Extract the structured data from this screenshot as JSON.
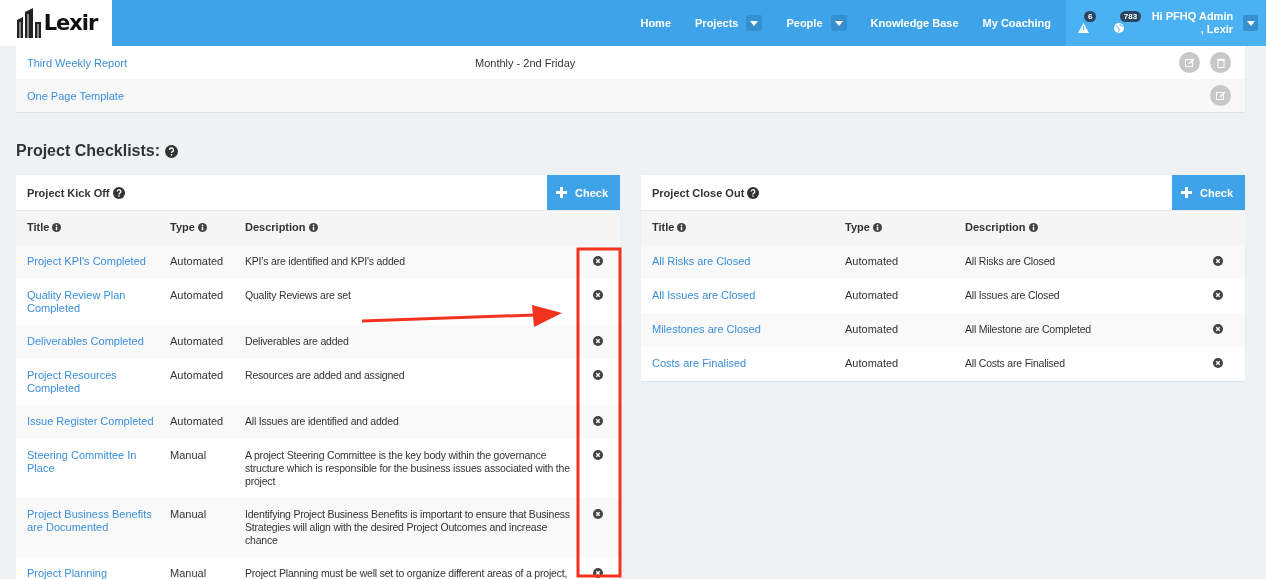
{
  "nav": {
    "logo": "Lexir",
    "items": [
      {
        "label": "Home",
        "dropdown": false
      },
      {
        "label": "Projects",
        "dropdown": true
      },
      {
        "label": "People",
        "dropdown": true
      },
      {
        "label": "Knowledge Base",
        "dropdown": false
      },
      {
        "label": "My Coaching",
        "dropdown": false
      }
    ],
    "alerts": [
      {
        "kind": "warning",
        "count": "6"
      },
      {
        "kind": "globe",
        "count": "783"
      }
    ],
    "user": "Hi PFHQ Admin , Lexir"
  },
  "reports": [
    {
      "name": "Third Weekly Report",
      "schedule": "Monthly - 2nd Friday",
      "actions": [
        {
          "kind": "edit"
        },
        {
          "kind": "delete"
        }
      ]
    },
    {
      "name": "One Page Template",
      "actions": [
        {
          "kind": "edit"
        }
      ]
    }
  ],
  "section_title": "Project Checklists:",
  "checklists": [
    {
      "title": "Project Kick Off",
      "add_label": "Check",
      "columns": [
        "Title",
        "Type",
        "Description"
      ],
      "rows": [
        {
          "title": "Project KPI's Completed",
          "type": "Automated",
          "description": "KPI’s are identified and KPI's added"
        },
        {
          "title": "Quality Review Plan Completed",
          "type": "Automated",
          "description": "Quality Reviews are set"
        },
        {
          "title": "Deliverables Completed",
          "type": "Automated",
          "description": "Deliverables are added"
        },
        {
          "title": "Project Resources Completed",
          "type": "Automated",
          "description": "Resources are added and assigned"
        },
        {
          "title": "Issue Register Completed",
          "type": "Automated",
          "description": "All Issues are identified and added"
        },
        {
          "title": "Steering Committee In Place",
          "type": "Manual",
          "description": "A project Steering Committee is the key body within the governance structure which is responsible for the business issues associated with the project"
        },
        {
          "title": "Project Business Benefits are Documented",
          "type": "Manual",
          "description": "Identifying Project Business Benefits is important to ensure that Business Strategies will align with the desired Project Outcomes and increase chance"
        },
        {
          "title": "Project Planning",
          "type": "Manual",
          "description": "Project Planning must be well set to organize different areas of a project,"
        }
      ]
    },
    {
      "title": "Project Close Out",
      "add_label": "Check",
      "columns": [
        "Title",
        "Type",
        "Description"
      ],
      "rows": [
        {
          "title": "All Risks are Closed",
          "type": "Automated",
          "description": "All Risks are Closed"
        },
        {
          "title": "All Issues are Closed",
          "type": "Automated",
          "description": "All Issues are Closed"
        },
        {
          "title": "Milestones are Closed",
          "type": "Automated",
          "description": "All Milestone are Completed"
        },
        {
          "title": "Costs are Finalised",
          "type": "Automated",
          "description": "All Costs are Finalised"
        }
      ]
    }
  ],
  "annotation": {
    "frame": true,
    "arrow": true
  }
}
